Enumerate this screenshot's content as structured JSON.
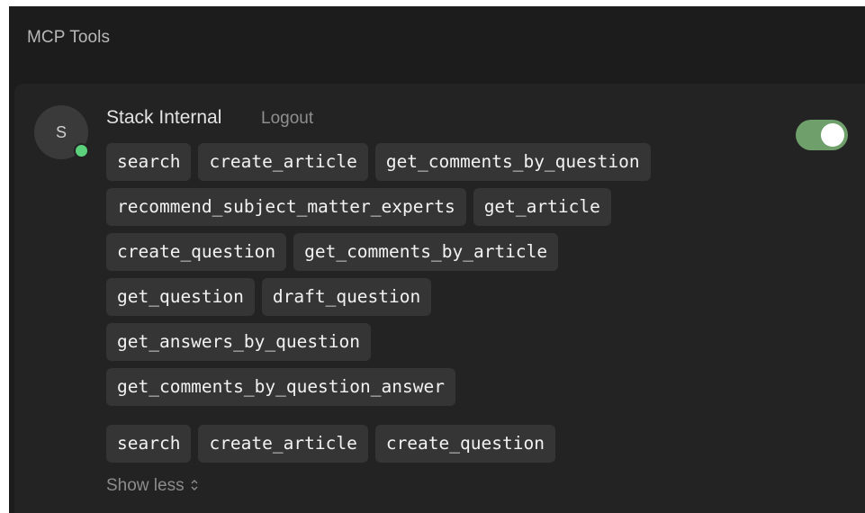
{
  "section": {
    "title": "MCP Tools"
  },
  "server": {
    "avatar_letter": "S",
    "name": "Stack Internal",
    "logout_label": "Logout",
    "enabled": true
  },
  "tools": {
    "all_rows": [
      [
        "search",
        "create_article",
        "get_comments_by_question"
      ],
      [
        "recommend_subject_matter_experts",
        "get_article"
      ],
      [
        "create_question",
        "get_comments_by_article"
      ],
      [
        "get_question",
        "draft_question"
      ],
      [
        "get_answers_by_question"
      ],
      [
        "get_comments_by_question_answer"
      ]
    ],
    "selected": [
      "search",
      "create_article",
      "create_question"
    ]
  },
  "show_less": {
    "label": "Show less",
    "icon": "chevron-updown-icon"
  },
  "colors": {
    "accent_toggle": "#6fa06b",
    "status_online": "#5ad17a",
    "background": "#1c1c1c"
  }
}
